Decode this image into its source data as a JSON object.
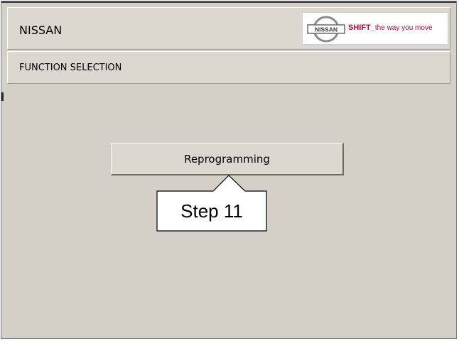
{
  "header": {
    "brand": "NISSAN",
    "logo": {
      "emblem_text": "NISSAN",
      "slogan_bold": "SHIFT_",
      "slogan_rest": "the way you move",
      "accent_color": "#c4003a"
    }
  },
  "subheader": {
    "title": "FUNCTION SELECTION"
  },
  "main": {
    "reprogramming_button": "Reprogramming"
  },
  "annotation": {
    "callout": "Step 11"
  }
}
